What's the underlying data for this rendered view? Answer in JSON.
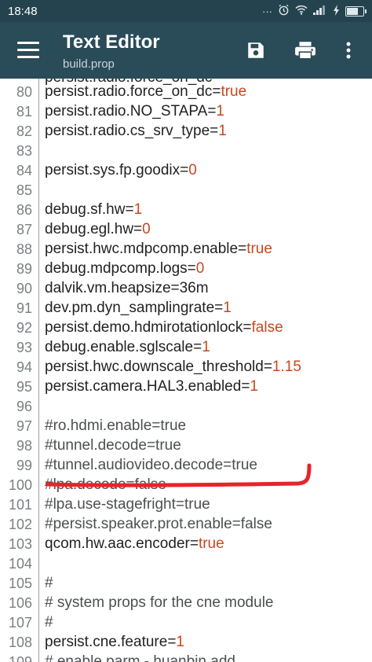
{
  "status_bar": {
    "time": "18:48",
    "icons": [
      "more-dots-icon",
      "alarm-icon",
      "wifi-icon",
      "signal-icon",
      "charging-icon",
      "battery-icon"
    ]
  },
  "app_bar": {
    "title": "Text Editor",
    "subtitle": "build.prop",
    "menu_icon": "hamburger-menu-icon",
    "actions": [
      "save-icon",
      "print-icon",
      "more-vert-icon"
    ]
  },
  "editor": {
    "partial_top_text": "persist.radio.force_on_dc",
    "lines": [
      {
        "n": "80",
        "key": "persist.radio.force_on_dc",
        "eq": "=",
        "val": "true",
        "comment": false
      },
      {
        "n": "81",
        "key": "persist.radio.NO_STAPA",
        "eq": "=",
        "val": "1",
        "comment": false
      },
      {
        "n": "82",
        "key": "persist.radio.cs_srv_type",
        "eq": "=",
        "val": "1",
        "comment": false
      },
      {
        "n": "83",
        "key": "",
        "eq": "",
        "val": "",
        "comment": false
      },
      {
        "n": "84",
        "key": "persist.sys.fp.goodix",
        "eq": "=",
        "val": "0",
        "comment": false
      },
      {
        "n": "85",
        "key": "",
        "eq": "",
        "val": "",
        "comment": false
      },
      {
        "n": "86",
        "key": "debug.sf.hw",
        "eq": "=",
        "val": "1",
        "comment": false
      },
      {
        "n": "87",
        "key": "debug.egl.hw",
        "eq": "=",
        "val": "0",
        "comment": false
      },
      {
        "n": "88",
        "key": "persist.hwc.mdpcomp.enable",
        "eq": "=",
        "val": "true",
        "comment": false
      },
      {
        "n": "89",
        "key": "debug.mdpcomp.logs",
        "eq": "=",
        "val": "0",
        "comment": false
      },
      {
        "n": "90",
        "key": "dalvik.vm.heapsize=36m",
        "eq": "",
        "val": "",
        "comment": false
      },
      {
        "n": "91",
        "key": "dev.pm.dyn_samplingrate",
        "eq": "=",
        "val": "1",
        "comment": false
      },
      {
        "n": "92",
        "key": "persist.demo.hdmirotationlock",
        "eq": "=",
        "val": "false",
        "comment": false
      },
      {
        "n": "93",
        "key": "debug.enable.sglscale",
        "eq": "=",
        "val": "1",
        "comment": false
      },
      {
        "n": "94",
        "key": "persist.hwc.downscale_threshold",
        "eq": "=",
        "val": "1.15",
        "comment": false
      },
      {
        "n": "95",
        "key": "persist.camera.HAL3.enabled",
        "eq": "=",
        "val": "1",
        "comment": false
      },
      {
        "n": "96",
        "key": "",
        "eq": "",
        "val": "",
        "comment": false
      },
      {
        "n": "97",
        "key": "#ro.hdmi.enable=true",
        "eq": "",
        "val": "",
        "comment": true
      },
      {
        "n": "98",
        "key": "#tunnel.decode=true",
        "eq": "",
        "val": "",
        "comment": true
      },
      {
        "n": "99",
        "key": "#tunnel.audiovideo.decode=true",
        "eq": "",
        "val": "",
        "comment": true
      },
      {
        "n": "100",
        "key": "#lpa.decode=false",
        "eq": "",
        "val": "",
        "comment": true
      },
      {
        "n": "101",
        "key": "#lpa.use-stagefright=true",
        "eq": "",
        "val": "",
        "comment": true
      },
      {
        "n": "102",
        "key": "#persist.speaker.prot.enable=false",
        "eq": "",
        "val": "",
        "comment": true
      },
      {
        "n": "103",
        "key": "qcom.hw.aac.encoder",
        "eq": "=",
        "val": "true",
        "comment": false
      },
      {
        "n": "104",
        "key": "",
        "eq": "",
        "val": "",
        "comment": false
      },
      {
        "n": "105",
        "key": "#",
        "eq": "",
        "val": "",
        "comment": true
      },
      {
        "n": "106",
        "key": "# system props for the cne module",
        "eq": "",
        "val": "",
        "comment": true
      },
      {
        "n": "107",
        "key": "#",
        "eq": "",
        "val": "",
        "comment": true
      },
      {
        "n": "108",
        "key": "persist.cne.feature",
        "eq": "=",
        "val": "1",
        "comment": false
      },
      {
        "n": "109",
        "key": "# enable parm - huanbin add",
        "eq": "",
        "val": "",
        "comment": true
      }
    ]
  },
  "colors": {
    "status_bar": "#24434f",
    "app_bar": "#2a4b58",
    "value": "#c8481e",
    "marker": "#e8232a"
  }
}
